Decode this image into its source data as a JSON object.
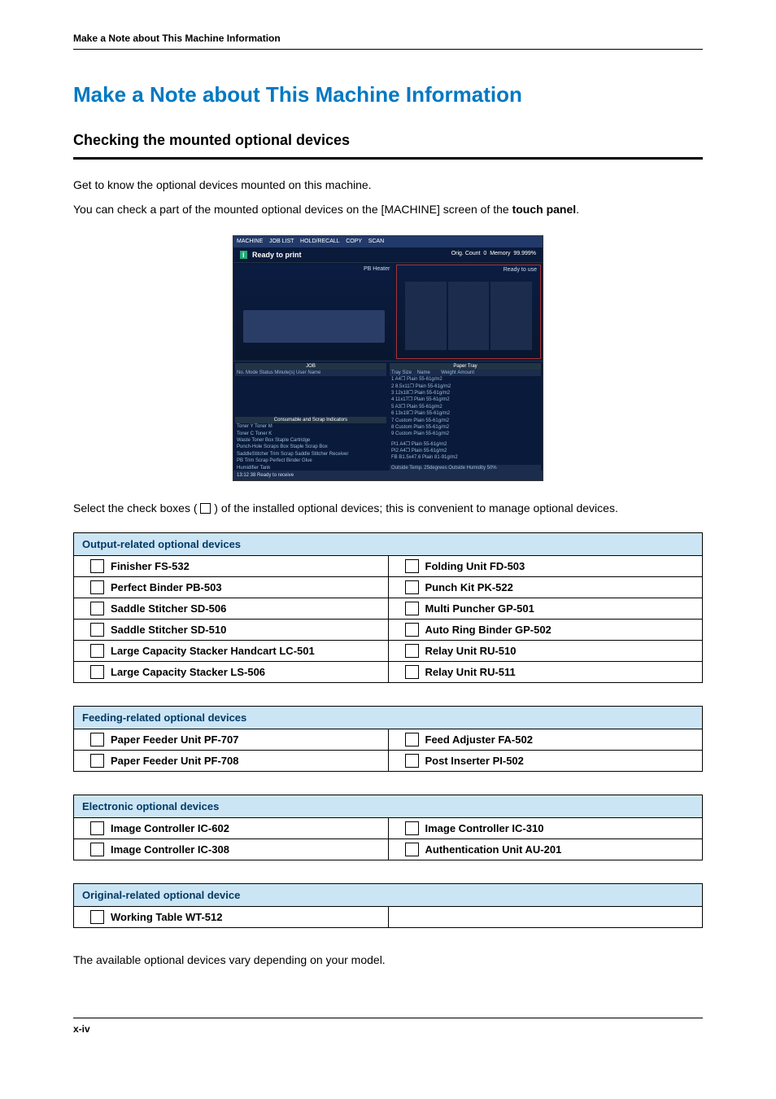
{
  "running_header": "Make a Note about This Machine Information",
  "main_title": "Make a Note about This Machine Information",
  "section_title": "Checking the mounted optional devices",
  "intro_1": "Get to know the optional devices mounted on this machine.",
  "intro_2_pre": "You can check a part of the mounted optional devices on the [MACHINE] screen of the ",
  "intro_2_bold": "touch panel",
  "intro_2_post": ".",
  "screenshot": {
    "ready": "Ready to print",
    "orig_count": "Orig. Count",
    "orig_value": "0",
    "memory_label": "Memory",
    "memory_value": "99.999%",
    "ready_use": "Ready to use",
    "pb_heater": "PB Heater",
    "job_header": "JOB",
    "paper_tray_header": "Paper Tray",
    "job_cols": "No.   Mode   Status   Minute(s)   User Name",
    "tray_rows": [
      "1    A4❐    Plain         55-61g/m2",
      "2    8.5x11❐  Plain         55-61g/m2",
      "3    12x18❐  Plain         55-61g/m2",
      "4    11x17❐  Plain         55-61g/m2",
      "5    A3❐    Plain         55-61g/m2",
      "6    13x19❐  Plain         55-61g/m2",
      "7    Custom  Plain         55-61g/m2",
      "8    Custom  Plain         55-61g/m2",
      "9    Custom  Plain         55-61g/m2"
    ],
    "consumable": "Consumable and Scrap Indicators",
    "rs_rows": [
      "PI1   A4❐   Plain         55-61g/m2",
      "PI2   A4❐   Plain         55-61g/m2",
      "FB    B1.5x47.6 Plain      81-91g/m2"
    ],
    "toner_rows": [
      "Toner Y        Toner M",
      "Toner C        Toner K",
      "Waste Toner Box     Staple Cartridge",
      "Punch-Hole Scraps Box    Staple Scrap Box",
      "SaddleStitcher Trim Scrap   Saddle Stitcher Receiver",
      "PB Trim Scrap        Perfect Binder Glue",
      "                Humidifier Tank"
    ],
    "outside_temp": "Outside Temp.   25degrees  Outside Humidity   50%",
    "bottom": "13:12 38   Ready to receive"
  },
  "checkbox_note_pre": "Select the check boxes ( ",
  "checkbox_note_post": " ) of the installed optional devices; this is convenient to manage optional devices.",
  "tables": {
    "output": {
      "header": "Output-related optional devices",
      "rows": [
        [
          "Finisher FS-532",
          "Folding Unit FD-503"
        ],
        [
          "Perfect Binder PB-503",
          "Punch Kit PK-522"
        ],
        [
          "Saddle Stitcher SD-506",
          "Multi Puncher GP-501"
        ],
        [
          "Saddle Stitcher SD-510",
          "Auto Ring Binder GP-502"
        ],
        [
          "Large Capacity Stacker Handcart LC-501",
          "Relay Unit RU-510"
        ],
        [
          "Large Capacity Stacker LS-506",
          "Relay Unit RU-511"
        ]
      ]
    },
    "feeding": {
      "header": "Feeding-related optional devices",
      "rows": [
        [
          "Paper Feeder Unit PF-707",
          "Feed Adjuster FA-502"
        ],
        [
          "Paper Feeder Unit PF-708",
          "Post Inserter PI-502"
        ]
      ]
    },
    "electronic": {
      "header": "Electronic optional devices",
      "rows": [
        [
          "Image Controller IC-602",
          "Image Controller IC-310"
        ],
        [
          "Image Controller IC-308",
          "Authentication Unit AU-201"
        ]
      ]
    },
    "original": {
      "header": "Original-related optional device",
      "rows": [
        [
          "Working Table WT-512",
          ""
        ]
      ]
    }
  },
  "closing_note": "The available optional devices vary depending on your model.",
  "page_number": "x-iv"
}
